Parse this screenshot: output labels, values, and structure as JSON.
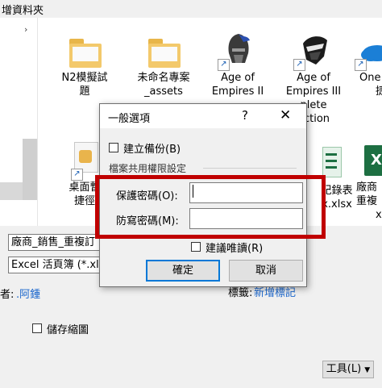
{
  "breadcrumb": "增資料夾",
  "files_row1": [
    {
      "label_line1": "N2模擬試",
      "label_line2": "題"
    },
    {
      "label_line1": "未命名專案",
      "label_line2": "_assets"
    },
    {
      "label_line1": "Age of",
      "label_line2": "Empires II"
    },
    {
      "label_line1": "Age of",
      "label_line2": "Empires III",
      "label_line3": "plete",
      "label_line4": "ection"
    },
    {
      "label_line1": "One",
      "label_line2": "捷"
    }
  ],
  "files_row2": [
    {
      "label_line1": "桌面暫",
      "label_line2": "捷徑"
    },
    {
      "label_line1": "紀錄表",
      "label_line2": "x.xlsx"
    },
    {
      "label_line1": "廠商",
      "label_line2": "重複",
      "label_line3": "x"
    }
  ],
  "form": {
    "filename_value": "廠商_銷售_重複訂",
    "filetype_value": "Excel 活頁簿 (*.xls",
    "author_label": "者:",
    "author_value": ".阿鍾",
    "tags_label": "標籤:",
    "tags_value": "新增標記",
    "thumbnail_label": "儲存縮圖",
    "tools_label": "工具(L)",
    "tools_arrow": "▼"
  },
  "dialog": {
    "title": "一般選項",
    "help": "?",
    "close": "✕",
    "backup_label": "建立備份(B)",
    "sharing_group": "檔案共用權限設定",
    "open_password_label": "保護密碼(O):",
    "open_password_value": "",
    "modify_password_label": "防寫密碼(M):",
    "modify_password_value": "",
    "readonly_label": "建議唯讀(R)",
    "ok_label": "確定",
    "cancel_label": "取消"
  },
  "colors": {
    "highlight_box": "#c00000",
    "default_button_border": "#0078d7",
    "link_blue": "#1a66cc"
  }
}
